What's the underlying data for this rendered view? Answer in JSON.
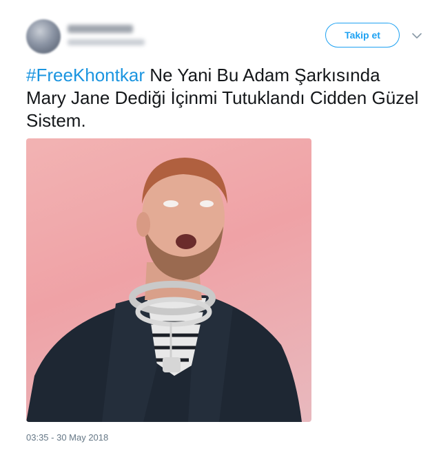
{
  "follow_label": "Takip et",
  "tweet": {
    "hashtag": "#FreeKhontkar",
    "body": " Ne Yani Bu Adam Şarkısında Mary Jane Dediği İçinmi Tutuklandı Cidden Güzel Sistem."
  },
  "timestamp": "03:35 - 30 May 2018",
  "icons": {
    "caret": "chevron-down-icon"
  },
  "colors": {
    "accent": "#1da1f2",
    "hashtag": "#1b95e0",
    "text": "#14171a",
    "muted": "#657786"
  }
}
